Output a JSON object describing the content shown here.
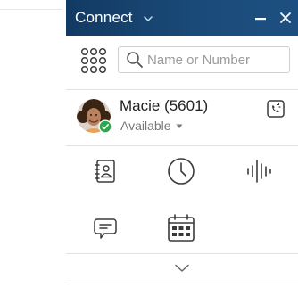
{
  "window": {
    "title": "Connect",
    "minimize_label": "—",
    "close_label": "✕"
  },
  "search": {
    "placeholder": "Name or Number",
    "value": ""
  },
  "user": {
    "name": "Macie (5601)",
    "status": "Available"
  },
  "quick_actions": [
    {
      "name": "contacts-icon"
    },
    {
      "name": "history-clock-icon"
    },
    {
      "name": "voice-waveform-icon"
    },
    {
      "name": "chat-icon"
    },
    {
      "name": "calendar-icon"
    }
  ],
  "icons": {
    "dialpad": "dialpad-icon",
    "search": "search-icon",
    "presence": "check-badge-icon",
    "voicemail": "voicemail-icon",
    "expand": "chevron-down-icon"
  },
  "colors": {
    "titlebar": "#1a4a78",
    "icon": "#3a3a3a",
    "presence": "#2aa84a"
  }
}
